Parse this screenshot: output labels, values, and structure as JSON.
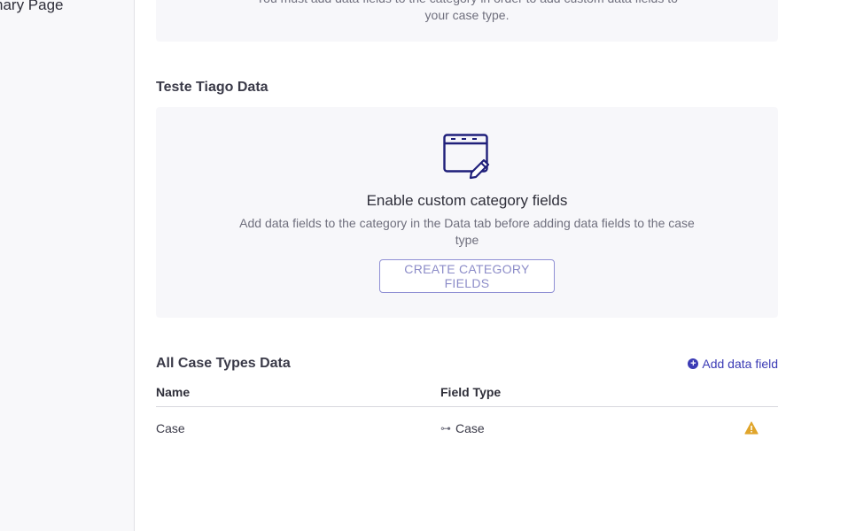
{
  "sidebar": {
    "item_partial": "nary Page"
  },
  "top_card": {
    "line1": "You must add data fields to the category in order to add custom data fields to",
    "line2": "your case type."
  },
  "category_section": {
    "title": "Teste Tiago Data",
    "empty_icon": "document-edit-icon",
    "empty_title": "Enable custom category fields",
    "empty_description": "Add data fields to the category in the Data tab before adding data fields to the case type",
    "button_label": "CREATE CATEGORY FIELDS"
  },
  "case_types_section": {
    "title": "All Case Types Data",
    "add_link_label": "Add data field",
    "columns": [
      "Name",
      "Field Type"
    ],
    "rows": [
      {
        "name": "Case",
        "field_type": "Case",
        "field_type_icon": "link-icon",
        "status_icon": "warning-icon"
      }
    ]
  },
  "colors": {
    "accent": "#3b3bb5",
    "warning": "#e0a52b",
    "card_bg": "#f7f7fa"
  }
}
